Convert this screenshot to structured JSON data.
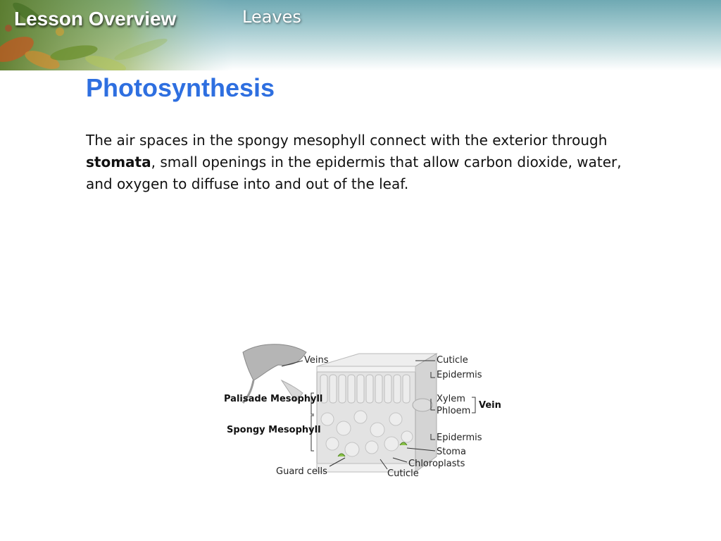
{
  "header": {
    "lesson_title": "Lesson Overview",
    "topic": "Leaves"
  },
  "slide": {
    "heading": "Photosynthesis",
    "paragraph_before": "The air spaces in the spongy mesophyll connect with the exterior through ",
    "paragraph_bold": "stomata",
    "paragraph_after": ", small openings in the epidermis that allow carbon dioxide, water, and oxygen to diffuse into and out of the leaf."
  },
  "diagram": {
    "labels": {
      "veins": "Veins",
      "cuticle_top": "Cuticle",
      "epidermis_top": "Epidermis",
      "xylem": "Xylem",
      "phloem": "Phloem",
      "vein": "Vein",
      "palisade": "Palisade Mesophyll",
      "spongy": "Spongy Mesophyll",
      "epidermis_bottom": "Epidermis",
      "stoma": "Stoma",
      "chloroplasts": "Chloroplasts",
      "guard_cells": "Guard cells",
      "cuticle_bottom": "Cuticle"
    }
  }
}
